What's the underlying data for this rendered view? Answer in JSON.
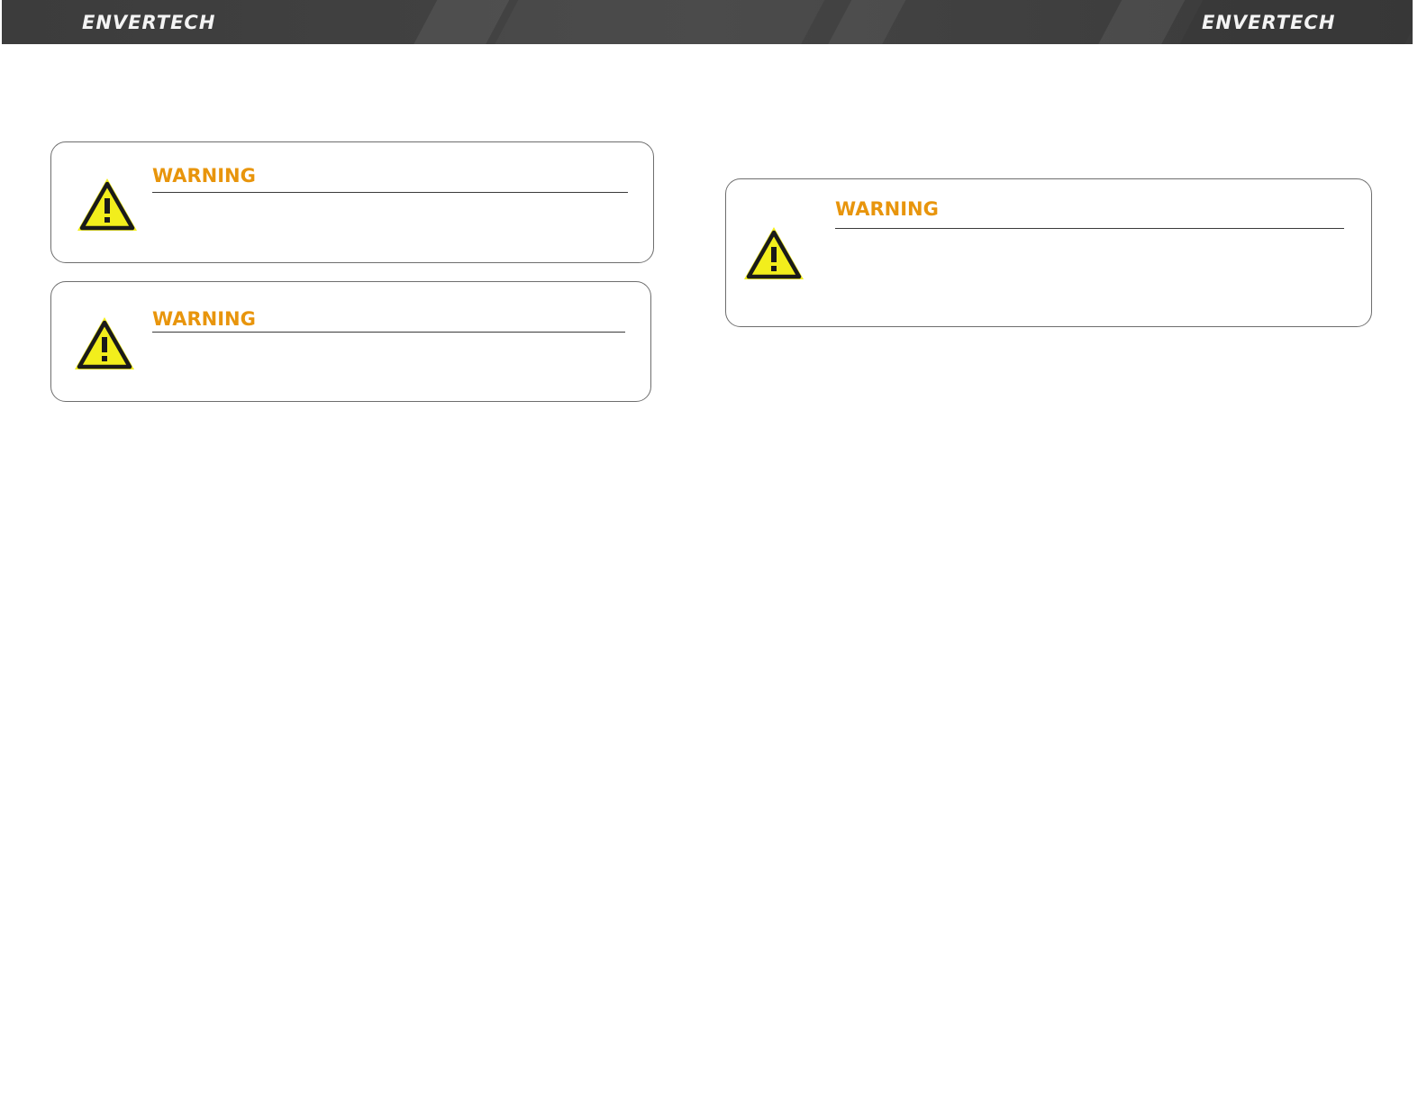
{
  "header": {
    "brand_left": "ENVERTECH",
    "brand_right": "ENVERTECH"
  },
  "warnings": [
    {
      "title": "WARNING",
      "icon": "warning-triangle-icon"
    },
    {
      "title": "WARNING",
      "icon": "warning-triangle-icon"
    },
    {
      "title": "WARNING",
      "icon": "warning-triangle-icon"
    }
  ],
  "colors": {
    "header_bg": "#404040",
    "brand_text": "#f4f4f4",
    "warning_title": "#e8950c",
    "icon_fill": "#f2ee1c",
    "icon_stroke": "#1a1a1a",
    "box_border": "#6e6e6e"
  }
}
